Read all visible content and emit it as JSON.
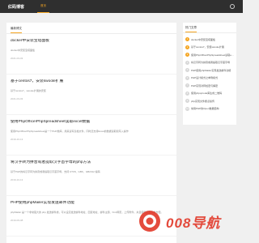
{
  "header": {
    "brand": "红码博客",
    "nav_home": "首页"
  },
  "main": {
    "section_title": "最新博文",
    "articles": [
      {
        "title": "docker中安装宝塔面板",
        "excerpt": "docker中安装宝塔面板",
        "date": "2021-03-03"
      },
      {
        "title": "基于centos7，安装swoole扩展",
        "excerpt": "基于centos7，swoole扩展的安装",
        "date": "2021-03-03"
      },
      {
        "title": "使用PhpOffice\\PhpSpreadsheet读取excel数据",
        "excerpt": "使用PhpOffice\\PhpSpreadsheet是一个PHP类库，用来读写表格文件，同时还支持Excel的数据读取和写入操作",
        "date": "2019-10-13"
      },
      {
        "title": "将汉字转为拼音或者提取汉字首字母的php方法",
        "excerpt": "基于PHP的将汉字转为拼音或者提取汉字首字母，支持 UTF8、GBK、GB2312 编码",
        "date": "2019-10-13"
      },
      {
        "title": "PHP使用phpMailer实现发送邮件功能",
        "excerpt": "phpMailer 是一个非常强大的 php 发送邮件类，可以设定发送邮件地址、回复地址、邮件主题、html网页，上传附件，并且使用起来非常方便。",
        "date": "2019-09-08"
      }
    ]
  },
  "sidebar": {
    "title": "热门文章",
    "items": [
      {
        "num": "1",
        "label": "docker中安装宝塔面板"
      },
      {
        "num": "2",
        "label": "基于centos7，安装swoole扩展"
      },
      {
        "num": "3",
        "label": "使用PhpOffice\\PhpSpreadsheet读取excel数据"
      },
      {
        "num": "4",
        "label": "将汉字转为拼音或者提取汉字首字母"
      },
      {
        "num": "5",
        "label": "PHP使用phpMailer实现发送邮件功能"
      },
      {
        "num": "6",
        "label": "PHP设计模式之单例模式"
      },
      {
        "num": "7",
        "label": "PHP实现对称加密与解密"
      },
      {
        "num": "8",
        "label": "使用phpqrcode库生成二维码"
      },
      {
        "num": "9",
        "label": "php实现文件断点续传"
      },
      {
        "num": "10",
        "label": "常用PHP的Open数据结构"
      }
    ]
  },
  "watermark": {
    "text": "008导航"
  },
  "colors": {
    "accent": "#f5a623",
    "topbar": "#2f2f2f",
    "watermark": "#e23c2d"
  }
}
